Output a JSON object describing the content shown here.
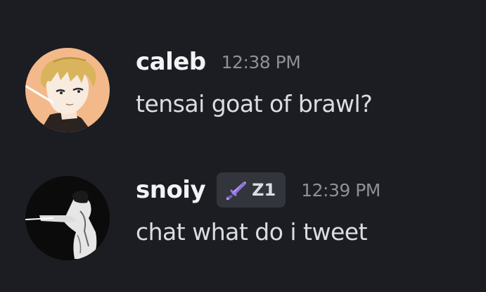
{
  "messages": [
    {
      "username": "caleb",
      "timestamp": "12:38 PM",
      "text": "tensai goat of brawl?",
      "avatar": "anime-boy-avatar"
    },
    {
      "username": "snoiy",
      "tag": {
        "icon": "sword-icon",
        "label": "Z1"
      },
      "timestamp": "12:39 PM",
      "text": "chat what do i tweet",
      "avatar": "monochrome-figure-avatar"
    }
  ],
  "colors": {
    "background": "#1c1d22",
    "username": "#f2f3f5",
    "message_text": "#dbdee1",
    "timestamp": "#8e9097",
    "tag_background": "#33353c",
    "tag_icon": "#b9a3f2"
  }
}
